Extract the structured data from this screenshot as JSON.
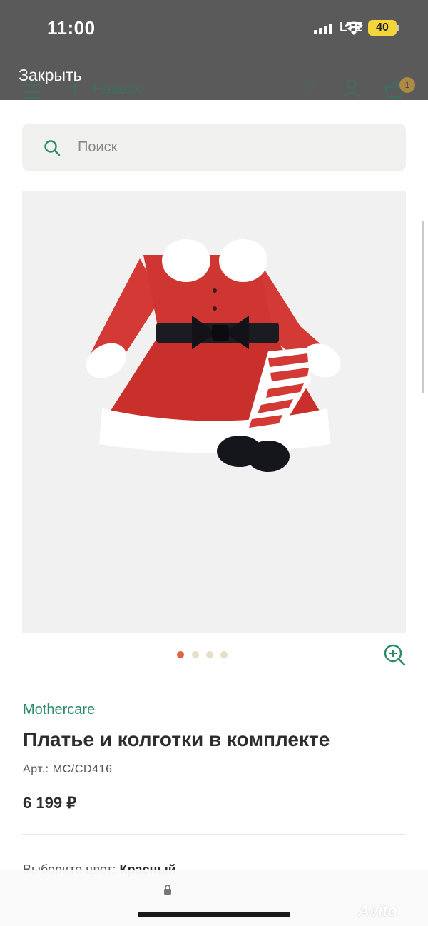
{
  "status_bar": {
    "time": "11:00",
    "network": "LTE",
    "battery": "40"
  },
  "overlay": {
    "close_label": "Закрыть"
  },
  "underlying_header": {
    "up_label": "Наверх",
    "cart_count": "1"
  },
  "search": {
    "placeholder": "Поиск"
  },
  "gallery": {
    "image_alt_icon": "product-photo",
    "dots_total": 4,
    "active_dot": 0
  },
  "product": {
    "brand": "Mothercare",
    "title": "Платье и колготки в комплекте",
    "sku": "Арт.: MC/CD416",
    "price": "6 199 ₽",
    "color_label": "Выберите цвет:",
    "color_value": "Красный"
  },
  "watermark": "Avito",
  "colors": {
    "accent_green": "#2b8a6a",
    "dot_active": "#e0663f",
    "dot_inactive": "#e4dfc6"
  }
}
